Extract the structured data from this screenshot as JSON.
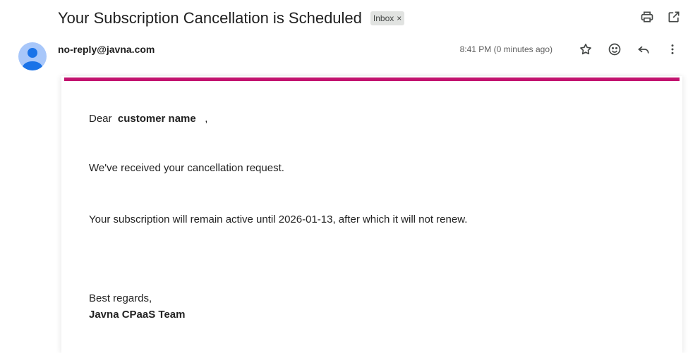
{
  "email": {
    "subject": "Your Subscription Cancellation is Scheduled",
    "label": "Inbox",
    "label_remove": "×",
    "sender": "no-reply@javna.com",
    "timestamp": "8:41 PM (0 minutes ago)"
  },
  "icons": {
    "print": "print-icon",
    "open_new_window": "open-in-new-window-icon",
    "star": "star-icon",
    "emoji": "emoji-icon",
    "reply": "reply-icon",
    "more": "more-vertical-icon",
    "avatar": "default-avatar-icon"
  },
  "body": {
    "greeting_prefix": "Dear",
    "customer_name": "customer name",
    "greeting_suffix": ",",
    "line1": "We've received your cancellation request.",
    "line2": "Your subscription will remain active until 2026-01-13, after which it will not renew.",
    "signoff": "Best regards,",
    "team": "Javna CPaaS Team"
  },
  "colors": {
    "accent": "#c2136f",
    "avatar_bg": "#a8c7fa",
    "avatar_fg": "#1a73e8",
    "chip_bg": "#e1e3e1"
  }
}
